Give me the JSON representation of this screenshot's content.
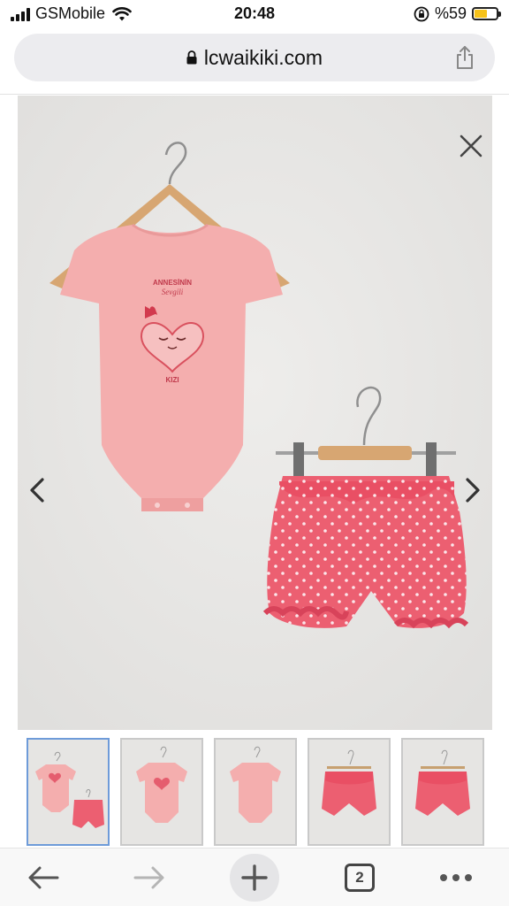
{
  "status_bar": {
    "carrier": "GSMobile",
    "time": "20:48",
    "battery_percent": "%59",
    "battery_level": 0.59,
    "battery_color": "#f6c21a"
  },
  "browser": {
    "url": "lcwaikiki.com",
    "open_tabs": "2"
  },
  "product": {
    "bodysuit_print": [
      "ANNESİNİN",
      "Sevgili",
      "KIZI"
    ],
    "bodysuit_color": "#f4aeae",
    "shorts_color": "#ec5f71"
  },
  "icons": {
    "close": "close-icon",
    "prev": "chevron-left-icon",
    "next": "chevron-right-icon",
    "back": "arrow-left-icon",
    "forward": "arrow-right-icon",
    "new_tab": "plus-icon",
    "menu": "more-dots-icon",
    "share": "share-icon",
    "lock": "padlock-icon"
  },
  "thumbnails": {
    "active_index": 0,
    "active_border_color": "#6e9bd9"
  }
}
